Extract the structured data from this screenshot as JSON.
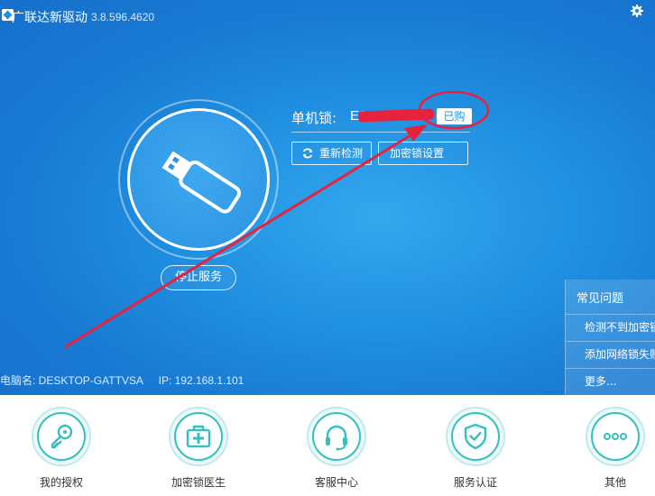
{
  "app": {
    "title": "广联达新驱动",
    "version": "3.8.596.4620"
  },
  "lock": {
    "label": "单机锁:",
    "id": "E32",
    "status_badge": "已购"
  },
  "buttons": {
    "recheck": "重新检测",
    "lock_settings": "加密锁设置",
    "stop_service": "停止服务"
  },
  "computer": {
    "name": "电脑名: DESKTOP-GATTVSA",
    "ip": "IP: 192.168.1.101"
  },
  "faq": {
    "title": "常见问题",
    "items": [
      "检测不到加密锁",
      "添加网络锁失败",
      "更多..."
    ]
  },
  "nav": [
    {
      "label": "我的授权",
      "icon": "key-icon"
    },
    {
      "label": "加密锁医生",
      "icon": "medical-kit-icon"
    },
    {
      "label": "客服中心",
      "icon": "headset-icon"
    },
    {
      "label": "服务认证",
      "icon": "shield-check-icon"
    },
    {
      "label": "其他",
      "icon": "more-dots-icon"
    }
  ],
  "colors": {
    "primary_blue": "#1f8fe0",
    "teal": "#35c0c0",
    "annotation_red": "#e8213d"
  }
}
